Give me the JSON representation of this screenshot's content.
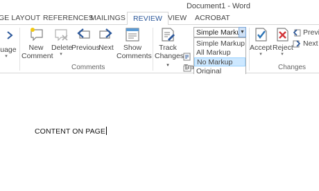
{
  "window": {
    "title": "Document1 - Word"
  },
  "tabs": [
    "GE LAYOUT",
    "REFERENCES",
    "MAILINGS",
    "REVIEW",
    "VIEW",
    "ACROBAT"
  ],
  "active_tab": "REVIEW",
  "ribbon": {
    "language": {
      "label": "guage"
    },
    "comments_group": {
      "label": "Comments",
      "new_comment": [
        "New",
        "Comment"
      ],
      "delete": "Delete",
      "previous": "Previous",
      "next": "Next",
      "show_comments": [
        "Show",
        "Comments"
      ]
    },
    "tracking_group": {
      "label": "Trac",
      "track_changes": [
        "Track",
        "Changes"
      ],
      "markup_combo": "Simple Markup",
      "markup_options": [
        "Simple Markup",
        "All Markup",
        "No Markup",
        "Original"
      ],
      "highlighted_option": "No Markup"
    },
    "changes_group": {
      "label": "Changes",
      "accept": "Accept",
      "reject": "Reject",
      "previous": "Previo",
      "next": "Next"
    }
  },
  "document": {
    "text": "CONTENT ON PAGE"
  },
  "colors": {
    "accent": "#2b579a",
    "hover": "#cde8ff",
    "check": "#2e75b6",
    "reject": "#d13438"
  }
}
